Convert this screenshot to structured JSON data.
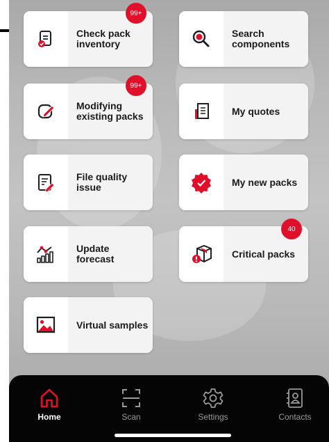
{
  "tiles": [
    {
      "id": "check-pack-inventory",
      "label": "Check pack\ninventory",
      "icon": "clipboard-check-icon",
      "badge": "99+"
    },
    {
      "id": "search-components",
      "label": "Search\ncomponents",
      "icon": "magnifier-icon",
      "badge": null
    },
    {
      "id": "modifying-existing-packs",
      "label": "Modifying\nexisting packs",
      "icon": "edit-icon",
      "badge": "99+"
    },
    {
      "id": "my-quotes",
      "label": "My quotes",
      "icon": "quote-document-icon",
      "badge": null
    },
    {
      "id": "file-quality-issue",
      "label": "File quality\nissue",
      "icon": "document-pen-icon",
      "badge": null
    },
    {
      "id": "my-new-packs",
      "label": "My new packs",
      "icon": "badge-check-icon",
      "badge": null
    },
    {
      "id": "update-forecast",
      "label": "Update\nforecast",
      "icon": "forecast-chart-icon",
      "badge": null
    },
    {
      "id": "critical-packs",
      "label": "Critical packs",
      "icon": "box-alert-icon",
      "badge": "40"
    },
    {
      "id": "virtual-samples",
      "label": "Virtual samples",
      "icon": "image-icon",
      "badge": null
    }
  ],
  "tabbar": {
    "tabs": [
      {
        "id": "home",
        "label": "Home",
        "icon": "home-icon",
        "active": true
      },
      {
        "id": "scan",
        "label": "Scan",
        "icon": "scan-icon",
        "active": false
      },
      {
        "id": "settings",
        "label": "Settings",
        "icon": "gear-icon",
        "active": false
      },
      {
        "id": "contacts",
        "label": "Contacts",
        "icon": "contacts-book-icon",
        "active": false
      }
    ]
  },
  "colors": {
    "accent": "#e0102a",
    "icon_dark": "#1f1f1f",
    "tile_label_bg": "#f3f3f3",
    "tabbar_bg": "#050505",
    "tab_inactive": "#9a9a9a"
  }
}
